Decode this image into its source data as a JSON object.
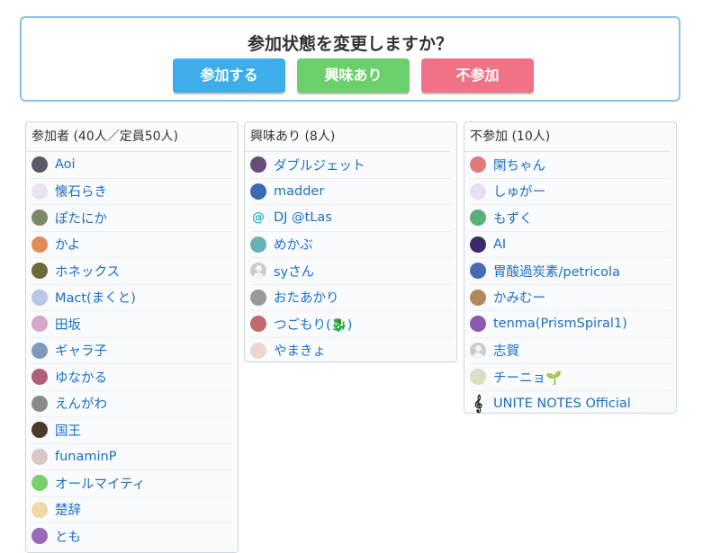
{
  "prompt": {
    "title": "参加状態を変更しますか？",
    "join_label": "参加する",
    "interest_label": "興味あり",
    "decline_label": "不参加"
  },
  "colors": {
    "join": "#3daee9",
    "interest": "#6cd06a",
    "decline": "#f17286",
    "link": "#1a6fc4"
  },
  "joined": {
    "header": "参加者 (40人／定員50人)",
    "members": [
      {
        "name": "Aoi",
        "avatar": "#5a5a66"
      },
      {
        "name": "懐石らき",
        "avatar": "#e9e4f2"
      },
      {
        "name": "ぽたにか",
        "avatar": "#7b8a6c"
      },
      {
        "name": "かよ",
        "avatar": "#e38a58"
      },
      {
        "name": "ホネックス",
        "avatar": "#6b6b3a"
      },
      {
        "name": "Mact(まくと)",
        "avatar": "#b9c8e6"
      },
      {
        "name": "田坂",
        "avatar": "#d9a8c8"
      },
      {
        "name": "ギャラ子",
        "avatar": "#7d9ab8"
      },
      {
        "name": "ゆなかる",
        "avatar": "#b0607a"
      },
      {
        "name": "えんがわ",
        "avatar": "#8a8a8a"
      },
      {
        "name": "国王",
        "avatar": "#4b3a28"
      },
      {
        "name": "funaminP",
        "avatar": "#d8c8c8"
      },
      {
        "name": "オールマイティ",
        "avatar": "#7ad06a"
      },
      {
        "name": "楚辞",
        "avatar": "#f0d8a8"
      },
      {
        "name": "とも",
        "avatar": "#9a6ab8"
      }
    ]
  },
  "interested": {
    "header": "興味あり (8人)",
    "members": [
      {
        "name": "ダブルジェット",
        "avatar": "#6a4a7a"
      },
      {
        "name": "madder",
        "avatar": "#3a6ab0"
      },
      {
        "name": "DJ @tLas",
        "avatar": "at"
      },
      {
        "name": "めかぶ",
        "avatar": "#6ab0b8"
      },
      {
        "name": "syさん",
        "avatar": "default"
      },
      {
        "name": "おたあかり",
        "avatar": "#9a9a9a"
      },
      {
        "name": "つごもり(🐉)",
        "avatar": "#c06a6a"
      },
      {
        "name": "やまきょ",
        "avatar": "#e8d8d0"
      }
    ]
  },
  "declined": {
    "header": "不参加 (10人)",
    "members": [
      {
        "name": "閑ちゃん",
        "avatar": "#e07a7a"
      },
      {
        "name": "しゅがー",
        "avatar": "#e8e0f0"
      },
      {
        "name": "もずく",
        "avatar": "#5ab07a"
      },
      {
        "name": "AI",
        "avatar": "#3a2a6a"
      },
      {
        "name": "胃酸過炭素/petricola",
        "avatar": "#4a6ab0"
      },
      {
        "name": "かみむー",
        "avatar": "#b08a5a"
      },
      {
        "name": "tenma(PrismSpiral1)",
        "avatar": "#8a5ab0"
      },
      {
        "name": "志賀",
        "avatar": "default"
      },
      {
        "name": "チーニョ🌱",
        "avatar": "#d8e0c0"
      },
      {
        "name": "UNITE NOTES Official",
        "avatar": "clef"
      }
    ]
  }
}
